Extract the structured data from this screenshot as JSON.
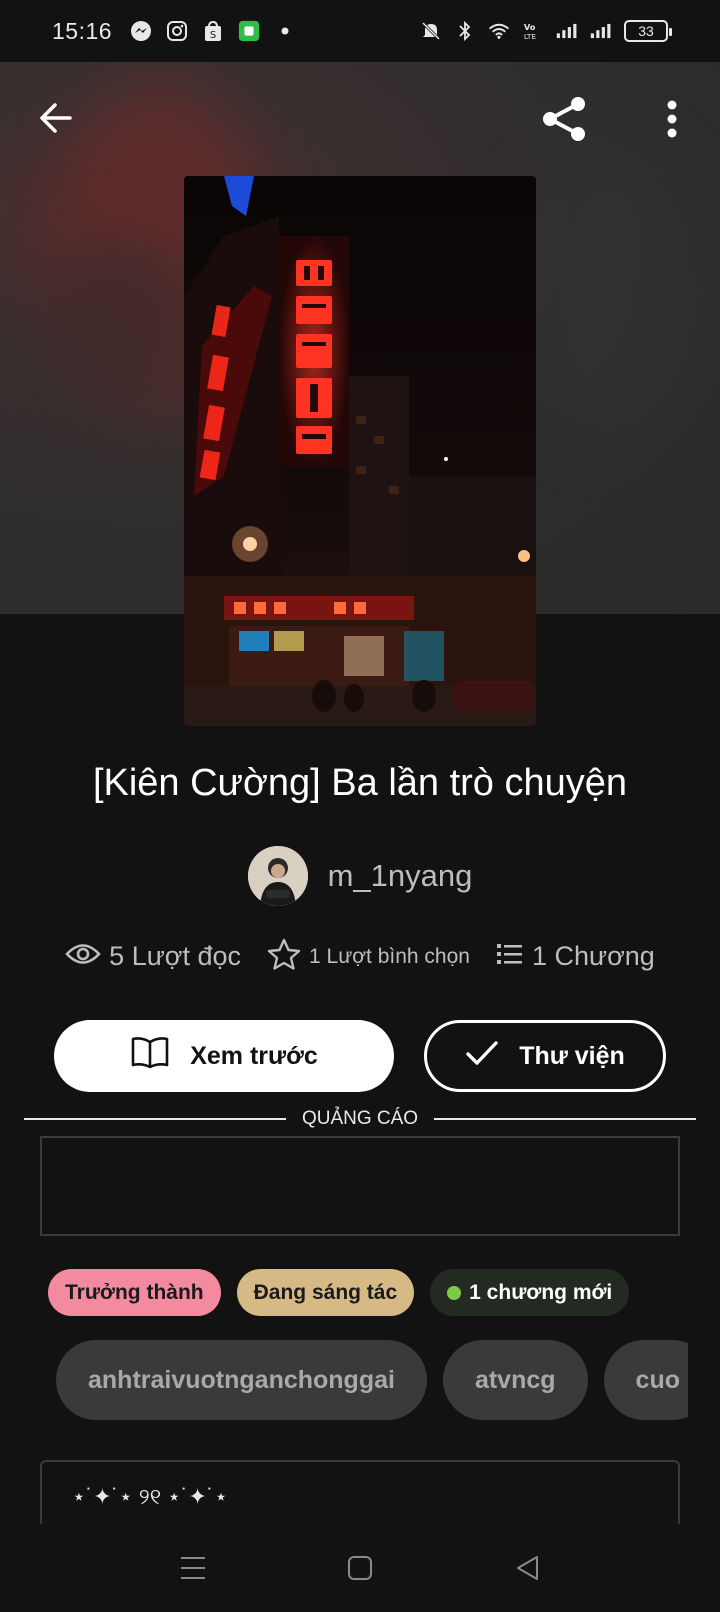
{
  "status_bar": {
    "time": "15:16",
    "battery": "33",
    "left_icons": [
      "messenger-icon",
      "instagram-icon",
      "shopee-icon",
      "app-icon",
      "dot-icon"
    ],
    "right_icons": [
      "mute-icon",
      "bluetooth-icon",
      "wifi-icon",
      "volte-icon",
      "signal-icon",
      "signal-icon",
      "battery-icon"
    ]
  },
  "appbar": {
    "back_icon": "arrow-left-icon",
    "share_icon": "share-icon",
    "more_icon": "more-vertical-icon"
  },
  "story": {
    "title": "[Kiên Cường] Ba lần trò chuyện",
    "author": "m_1nyang",
    "stats": {
      "reads": "5 Lượt đọc",
      "votes": "1 Lượt bình chọn",
      "chapters": "1 Chương"
    }
  },
  "actions": {
    "preview_label": "Xem trước",
    "library_label": "Thư viện"
  },
  "ad": {
    "label": "QUẢNG CÁO"
  },
  "chips": {
    "mature": "Trưởng thành",
    "ongoing": "Đang sáng tác",
    "new_chapters": "1 chương mới"
  },
  "tags": [
    "anhtraivuotnganchonggai",
    "atvncg",
    "cuo"
  ],
  "description": {
    "first_line": "⋆˙✦˙⋆ ୨୧ ⋆˙✦˙⋆"
  },
  "colors": {
    "background": "#121212",
    "chip_mature": "#f48aa0",
    "chip_ongoing": "#d6b985",
    "chip_new_dot": "#7ec84a",
    "tag_bg": "#3a3a3a"
  }
}
